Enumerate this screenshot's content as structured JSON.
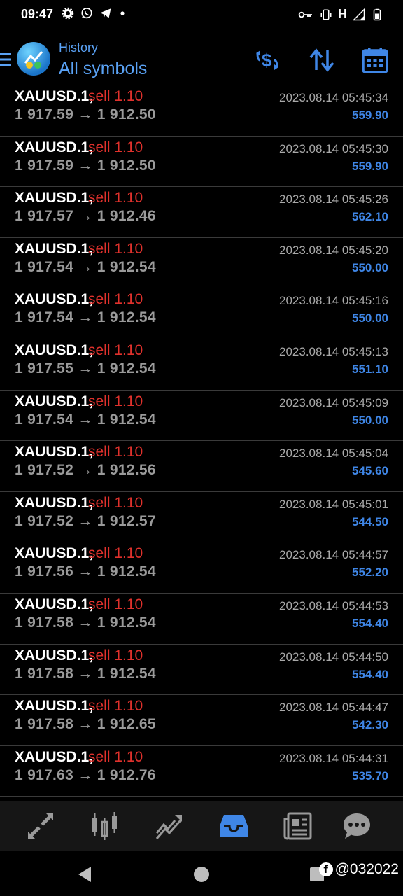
{
  "status_bar": {
    "time": "09:47",
    "network_label": "H",
    "left_icons": [
      "settings-icon",
      "whatsapp-icon",
      "telegram-icon",
      "dot-icon"
    ],
    "right_icons": [
      "key-icon",
      "vibrate-icon",
      "signal-icon",
      "battery-icon"
    ]
  },
  "header": {
    "subtitle": "History",
    "title": "All symbols",
    "accent_color": "#5aa2f5",
    "actions": [
      "currency-swap-icon",
      "sort-icon",
      "calendar-icon"
    ]
  },
  "trades": [
    {
      "symbol": "XAUUSD.1,",
      "side": "sell 1.10",
      "open": "1 917.59",
      "close": "1 912.50",
      "time": "2023.08.14 05:45:34",
      "profit": "559.90"
    },
    {
      "symbol": "XAUUSD.1,",
      "side": "sell 1.10",
      "open": "1 917.59",
      "close": "1 912.50",
      "time": "2023.08.14 05:45:30",
      "profit": "559.90"
    },
    {
      "symbol": "XAUUSD.1,",
      "side": "sell 1.10",
      "open": "1 917.57",
      "close": "1 912.46",
      "time": "2023.08.14 05:45:26",
      "profit": "562.10"
    },
    {
      "symbol": "XAUUSD.1,",
      "side": "sell 1.10",
      "open": "1 917.54",
      "close": "1 912.54",
      "time": "2023.08.14 05:45:20",
      "profit": "550.00"
    },
    {
      "symbol": "XAUUSD.1,",
      "side": "sell 1.10",
      "open": "1 917.54",
      "close": "1 912.54",
      "time": "2023.08.14 05:45:16",
      "profit": "550.00"
    },
    {
      "symbol": "XAUUSD.1,",
      "side": "sell 1.10",
      "open": "1 917.55",
      "close": "1 912.54",
      "time": "2023.08.14 05:45:13",
      "profit": "551.10"
    },
    {
      "symbol": "XAUUSD.1,",
      "side": "sell 1.10",
      "open": "1 917.54",
      "close": "1 912.54",
      "time": "2023.08.14 05:45:09",
      "profit": "550.00"
    },
    {
      "symbol": "XAUUSD.1,",
      "side": "sell 1.10",
      "open": "1 917.52",
      "close": "1 912.56",
      "time": "2023.08.14 05:45:04",
      "profit": "545.60"
    },
    {
      "symbol": "XAUUSD.1,",
      "side": "sell 1.10",
      "open": "1 917.52",
      "close": "1 912.57",
      "time": "2023.08.14 05:45:01",
      "profit": "544.50"
    },
    {
      "symbol": "XAUUSD.1,",
      "side": "sell 1.10",
      "open": "1 917.56",
      "close": "1 912.54",
      "time": "2023.08.14 05:44:57",
      "profit": "552.20"
    },
    {
      "symbol": "XAUUSD.1,",
      "side": "sell 1.10",
      "open": "1 917.58",
      "close": "1 912.54",
      "time": "2023.08.14 05:44:53",
      "profit": "554.40"
    },
    {
      "symbol": "XAUUSD.1,",
      "side": "sell 1.10",
      "open": "1 917.58",
      "close": "1 912.54",
      "time": "2023.08.14 05:44:50",
      "profit": "554.40"
    },
    {
      "symbol": "XAUUSD.1,",
      "side": "sell 1.10",
      "open": "1 917.58",
      "close": "1 912.65",
      "time": "2023.08.14 05:44:47",
      "profit": "542.30"
    },
    {
      "symbol": "XAUUSD.1,",
      "side": "sell 1.10",
      "open": "1 917.63",
      "close": "1 912.76",
      "time": "2023.08.14 05:44:31",
      "profit": "535.70"
    }
  ],
  "bottom_nav": {
    "items": [
      "quotes-icon",
      "chart-icon",
      "trade-icon",
      "history-icon",
      "news-icon",
      "chat-icon"
    ],
    "active": "history-icon",
    "active_color": "#3f86e6",
    "inactive_color": "#9a9a9a"
  },
  "watermark": {
    "logo": "f",
    "handle": "@032022"
  },
  "colors": {
    "sell": "#e0312c",
    "profit": "#3f86e6"
  }
}
